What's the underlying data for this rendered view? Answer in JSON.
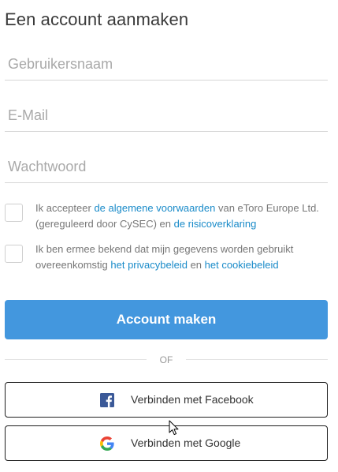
{
  "page": {
    "title": "Een account aanmaken"
  },
  "form": {
    "username_placeholder": "Gebruikersnaam",
    "email_placeholder": "E-Mail",
    "password_placeholder": "Wachtwoord"
  },
  "consent_terms": {
    "prefix": "Ik accepteer ",
    "link1": "de algemene voorwaarden",
    "middle": " van eToro Europe Ltd. (gereguleerd door CySEC) en ",
    "link2": "de risicoverklaring"
  },
  "consent_privacy": {
    "prefix": "Ik ben ermee bekend dat mijn gegevens worden gebruikt overeenkomstig ",
    "link1": "het privacybeleid",
    "middle": " en ",
    "link2": "het cookiebeleid"
  },
  "actions": {
    "create_account_label": "Account maken",
    "divider_text": "OF",
    "facebook_label": "Verbinden met Facebook",
    "google_label": "Verbinden met Google"
  },
  "colors": {
    "primary": "#4397de",
    "link": "#1a8bc9",
    "facebook": "#3b5998"
  },
  "icons": [
    "facebook-icon",
    "google-icon",
    "mouse-cursor-icon"
  ]
}
